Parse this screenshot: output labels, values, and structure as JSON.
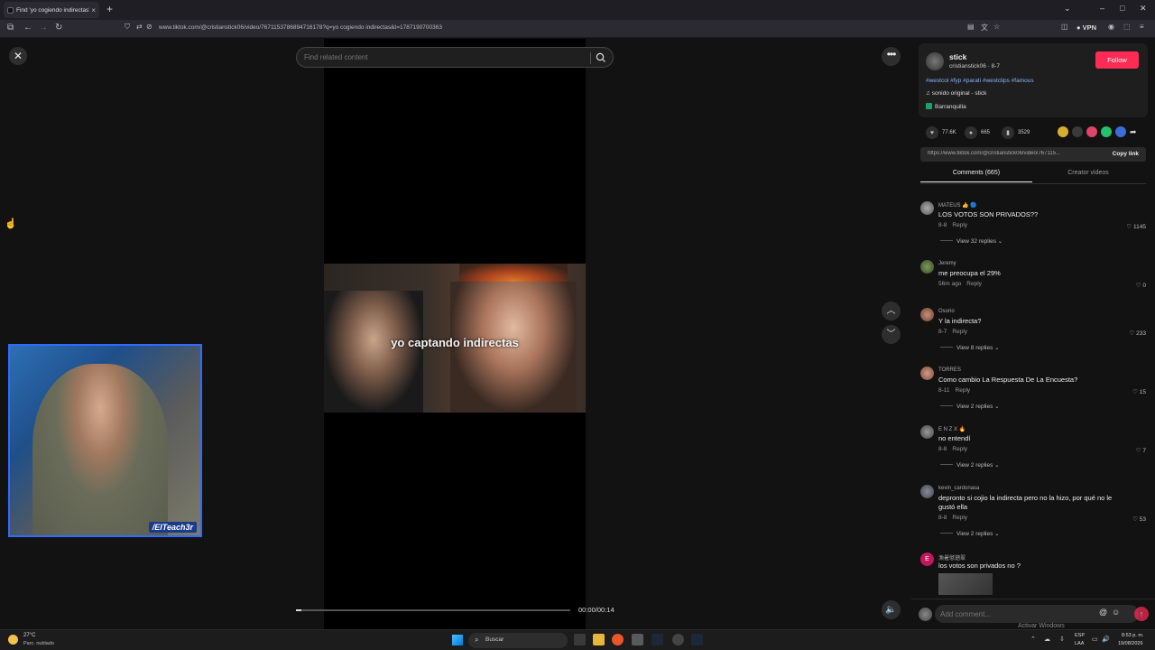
{
  "browser": {
    "tab_title": "Find 'yo cogiendo indirectas' o",
    "tab_close": "×",
    "new_tab": "+",
    "url": "www.tiktok.com/@cristianstick06/video/7671153786894716178?q=yo cogiendo indirectas&t=1787190700363",
    "vpn_label": "VPN",
    "minimize": "–",
    "maximize": "□",
    "close": "✕"
  },
  "search": {
    "placeholder": "Find related content"
  },
  "video": {
    "caption": "yo captando indirectas",
    "time": "00:00/00:14",
    "progress": 0.02
  },
  "webcam": {
    "tag": "/ElTeach3r"
  },
  "post": {
    "username": "stick",
    "handle": "cristianstick06 · 8-7",
    "follow_label": "Follow",
    "hashtags": "#westcol #fyp #parati #westclips #famous",
    "sound": "sonido original - stick",
    "location": "Barranquilla",
    "likes": "77.6K",
    "comments_count": "665",
    "saves": "3529",
    "link": "https://www.tiktok.com/@cristianstick06/video/767115...",
    "copy_link": "Copy link"
  },
  "tabs": {
    "comments": "Comments (665)",
    "creator": "Creator videos"
  },
  "comments": [
    {
      "user": "MATEUS 👍 🔵",
      "text": "LOS VOTOS SON PRIVADOS??",
      "date": "8-8",
      "reply": "Reply",
      "likes": "1145",
      "replies": "View 32 replies"
    },
    {
      "user": "Jeremy",
      "text": "me preocupa el 29%",
      "date": "56m ago",
      "reply": "Reply",
      "likes": "0",
      "replies": ""
    },
    {
      "user": "Osorio",
      "text": "Y la indirecta?",
      "date": "8-7",
      "reply": "Reply",
      "likes": "233",
      "replies": "View 8 replies"
    },
    {
      "user": "TORRES",
      "text": "Como cambio La Respuesta De La Encuesta?",
      "date": "8-11",
      "reply": "Reply",
      "likes": "15",
      "replies": "View 2 replies"
    },
    {
      "user": "E N Z X 🔥",
      "text": "no entendí",
      "date": "8-8",
      "reply": "Reply",
      "likes": "7",
      "replies": "View 2 replies"
    },
    {
      "user": "kevin_cardonasa",
      "text": "depronto si cojio la indirecta pero no la hizo, por qué no le gustó ella",
      "date": "8-8",
      "reply": "Reply",
      "likes": "53",
      "replies": "View 2 replies"
    },
    {
      "user": "漁暑懲遡翠",
      "text": "los votos son privados no ?",
      "avatar_letter": "E"
    }
  ],
  "add_comment": {
    "placeholder": "Add comment..."
  },
  "watermark": {
    "line1": "Activar Windows",
    "line2": "Ve a Configuración para activar Windows."
  },
  "taskbar": {
    "temp": "27°C",
    "weather": "Parc. nublado",
    "search_label": "Buscar",
    "lang1": "ESP",
    "lang2": "LAA",
    "time": "8:53 p. m.",
    "date": "19/08/2026"
  },
  "colors": {
    "accent": "#fe2c55",
    "hashtag": "#8ab4f8"
  }
}
